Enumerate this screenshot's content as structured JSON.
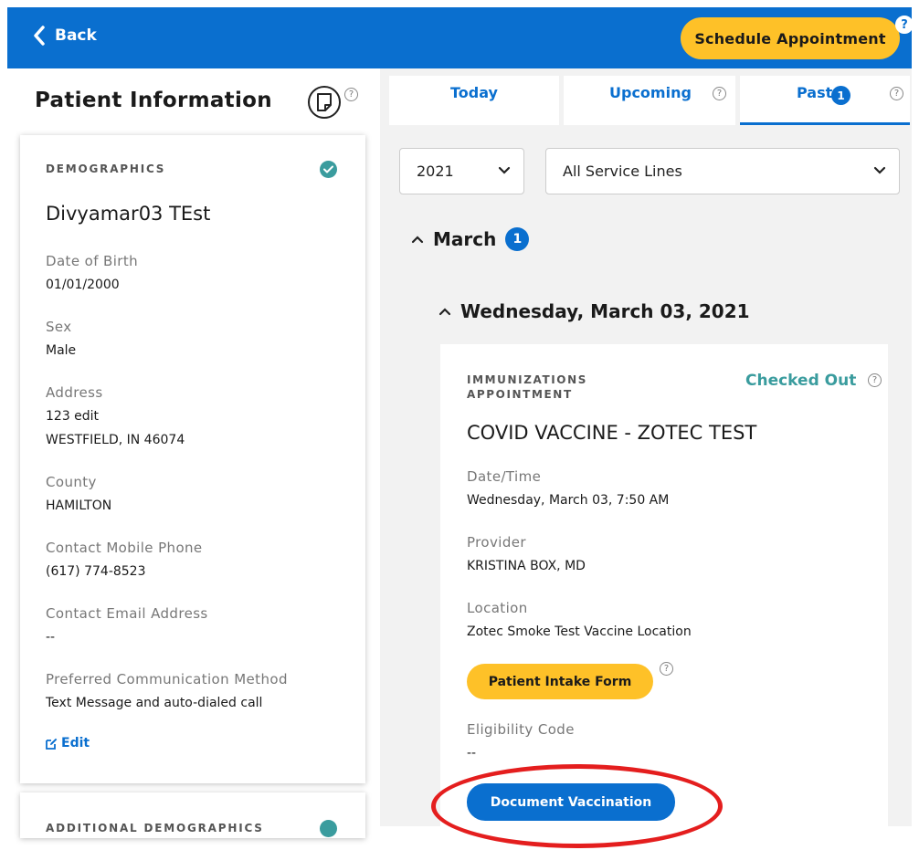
{
  "header": {
    "back_label": "Back",
    "schedule_label": "Schedule Appointment",
    "help_glyph": "?"
  },
  "left": {
    "title": "Patient Information",
    "demographics": {
      "heading": "DEMOGRAPHICS",
      "patient_name": "Divyamar03 TEst",
      "fields": [
        {
          "label": "Date of Birth",
          "value": "01/01/2000"
        },
        {
          "label": "Sex",
          "value": "Male"
        },
        {
          "label": "Address",
          "value": "123 edit",
          "value2": "WESTFIELD, IN 46074"
        },
        {
          "label": "County",
          "value": "HAMILTON"
        },
        {
          "label": "Contact Mobile Phone",
          "value": "(617) 774-8523"
        },
        {
          "label": "Contact Email Address",
          "value": "--"
        },
        {
          "label": "Preferred Communication Method",
          "value": "Text Message and auto-dialed call"
        }
      ],
      "edit_label": "Edit"
    },
    "additional_heading": "ADDITIONAL DEMOGRAPHICS"
  },
  "tabs": [
    {
      "label": "Today"
    },
    {
      "label": "Upcoming"
    },
    {
      "label": "Past",
      "badge": "1"
    }
  ],
  "filters": {
    "year": "2021",
    "service_line": "All Service Lines"
  },
  "month_group": {
    "label": "March",
    "badge": "1"
  },
  "day_group": {
    "label": "Wednesday, March 03, 2021"
  },
  "appointment": {
    "type": "IMMUNIZATIONS APPOINTMENT",
    "status": "Checked Out",
    "title": "COVID VACCINE - ZOTEC TEST",
    "datetime_label": "Date/Time",
    "datetime_value": "Wednesday, March 03, 7:50 AM",
    "provider_label": "Provider",
    "provider_value": "KRISTINA BOX, MD",
    "location_label": "Location",
    "location_value": "Zotec Smoke Test Vaccine Location",
    "intake_button": "Patient Intake Form",
    "eligibility_label": "Eligibility Code",
    "eligibility_value": "--",
    "document_button": "Document Vaccination"
  },
  "colors": {
    "brand_blue": "#0a6fcf",
    "accent_yellow": "#fec128",
    "status_teal": "#3a9c9e",
    "annotation_red": "#e41e1e"
  },
  "icons": [
    "chevron-left-icon",
    "note-icon",
    "help-icon",
    "check-circle-icon",
    "chevron-down-icon",
    "chevron-up-icon",
    "edit-icon"
  ]
}
